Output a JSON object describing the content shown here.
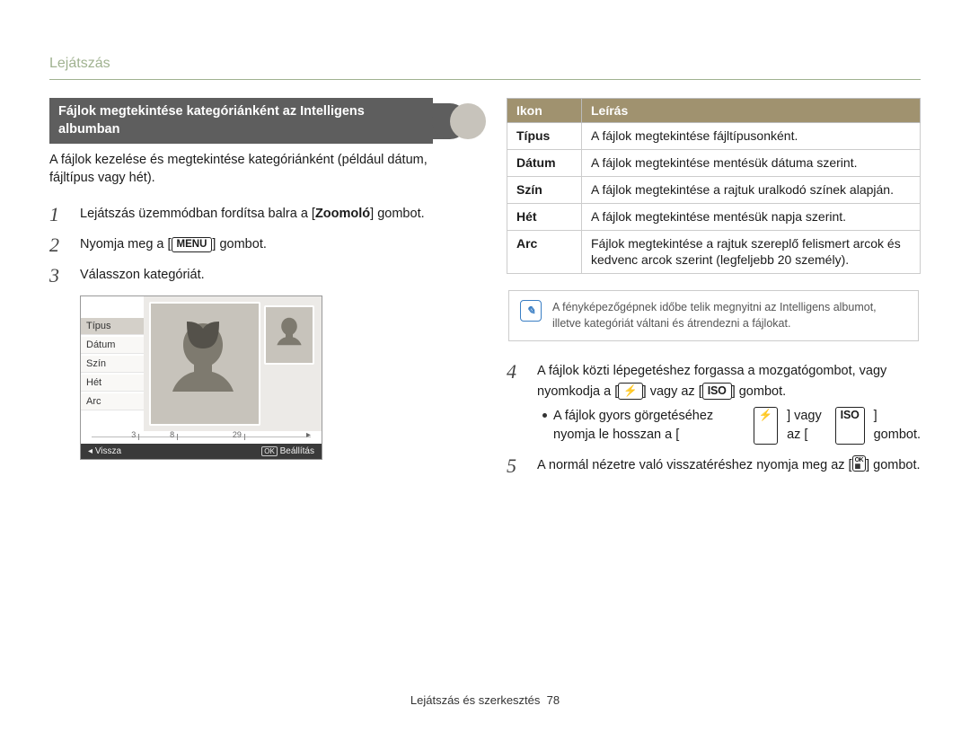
{
  "page_header": "Lejátszás",
  "footer": {
    "label": "Lejátszás és szerkesztés",
    "page": "78"
  },
  "left": {
    "subhead": "Fájlok megtekintése kategóriánként az Intelligens albumban",
    "intro": "A fájlok kezelése és megtekintése kategóriánként (például dátum, fájltípus vagy hét).",
    "steps": {
      "s1_a": "Lejátszás üzemmódban fordítsa balra a [",
      "s1_b": "Zoomoló",
      "s1_c": "] gombot.",
      "s2_a": "Nyomja meg a [",
      "s2_btn": "MENU",
      "s2_b": "] gombot.",
      "s3": "Válasszon kategóriát."
    },
    "screen": {
      "menu": [
        "Típus",
        "Dátum",
        "Szín",
        "Hét",
        "Arc"
      ],
      "strip_labels": [
        "3",
        "8",
        "29"
      ],
      "bar_back": "Vissza",
      "bar_ok": "OK",
      "bar_set": "Beállítás"
    }
  },
  "right": {
    "table": {
      "h1": "Ikon",
      "h2": "Leírás",
      "rows": [
        {
          "k": "Típus",
          "v": "A fájlok megtekintése fájltípusonként."
        },
        {
          "k": "Dátum",
          "v": "A fájlok megtekintése mentésük dátuma szerint."
        },
        {
          "k": "Szín",
          "v": "A fájlok megtekintése a rajtuk uralkodó színek alapján."
        },
        {
          "k": "Hét",
          "v": "A fájlok megtekintése mentésük napja szerint."
        },
        {
          "k": "Arc",
          "v": "Fájlok megtekintése a rajtuk szereplő felismert arcok és kedvenc arcok szerint (legfeljebb 20 személy)."
        }
      ]
    },
    "note": "A fényképezőgépnek időbe telik megnyitni az Intelligens albumot, illetve kategóriát váltani és átrendezni a fájlokat.",
    "steps": {
      "s4_a": "A fájlok közti lépegetéshez forgassa a mozgatógombot, vagy nyomkodja a [",
      "s4_icon1": "flash-icon",
      "s4_b": "] vagy az [",
      "s4_icon2": "ISO",
      "s4_c": "] gombot.",
      "s4_sub_a": "A fájlok gyors görgetéséhez nyomja le hosszan a [",
      "s4_sub_b": "] vagy az [",
      "s4_sub_c": "] gombot.",
      "s5_a": "A normál nézetre való visszatéréshez nyomja meg az [",
      "s5_icon": "OK",
      "s5_b": "] gombot."
    }
  }
}
